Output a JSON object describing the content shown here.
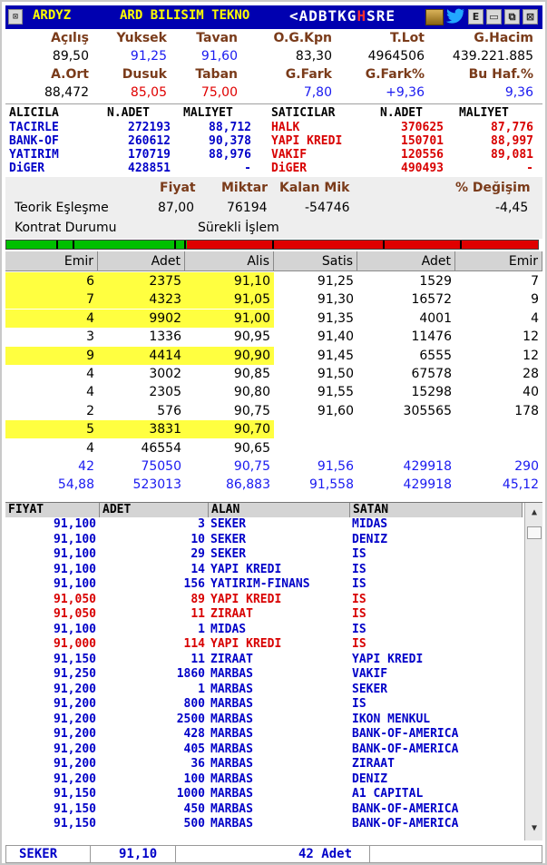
{
  "title": {
    "close": "⊠",
    "symbol": "ARDYZ",
    "company": "ARD BILISIM TEKNO",
    "flags_pre": "<ADBTKG",
    "flags_hl": "H",
    "flags_post": "SRE",
    "bird_icon": "twitter-bird",
    "btn_e": "E",
    "btn_min": "▭",
    "btn_max": "⧉",
    "btn_close": "⊠"
  },
  "summary": {
    "labels1": [
      "Açılış",
      "Yuksek",
      "Tavan",
      "O.G.Kpn",
      "T.Lot",
      "G.Hacim"
    ],
    "values1": [
      "89,50",
      "91,25",
      "91,60",
      "83,30",
      "4964506",
      "439.221.885"
    ],
    "labels2": [
      "A.Ort",
      "Dusuk",
      "Taban",
      "G.Fark",
      "G.Fark%",
      "Bu Haf.%"
    ],
    "values2": [
      "88,472",
      "85,05",
      "75,00",
      "7,80",
      "+9,36",
      "9,36"
    ]
  },
  "brokers": {
    "buy_headers": [
      "ALICILA",
      "N.ADET",
      "MALIYET"
    ],
    "sell_headers": [
      "SATICILAR",
      "N.ADET",
      "MALIYET"
    ],
    "rows": [
      {
        "buyer": "TACIRLE",
        "bq": "272193",
        "bc": "88,712",
        "seller": "HALK",
        "sq": "370625",
        "sc": "87,776"
      },
      {
        "buyer": "BANK-OF",
        "bq": "260612",
        "bc": "90,378",
        "seller": "YAPI KREDI",
        "sq": "150701",
        "sc": "88,997"
      },
      {
        "buyer": "YATIRIM",
        "bq": "170719",
        "bc": "88,976",
        "seller": "VAKIF",
        "sq": "120556",
        "sc": "89,081"
      },
      {
        "buyer": "DiGER",
        "bq": "428851",
        "bc": "-",
        "seller": "DiGER",
        "sq": "490493",
        "sc": "-"
      }
    ]
  },
  "theoretical": {
    "h_price": "Fiyat",
    "h_qty": "Miktar",
    "h_rem": "Kalan Mik",
    "h_chg": "% Değişim",
    "label": "Teorik Eşleşme",
    "price": "87,00",
    "qty": "76194",
    "rem": "-54746",
    "chg": "-4,45",
    "contract_label": "Kontrat Durumu",
    "contract_value": "Sürekli İşlem"
  },
  "depth_bar": {
    "buy_fraction": 0.34
  },
  "book": {
    "headers": [
      "Emir",
      "Adet",
      "Alis",
      "Satis",
      "Adet",
      "Emir"
    ],
    "rows": [
      {
        "be": "6",
        "ba": "2375",
        "bp": "91,10",
        "sp": "91,25",
        "sa": "1529",
        "se": "7",
        "hl": true
      },
      {
        "be": "7",
        "ba": "4323",
        "bp": "91,05",
        "sp": "91,30",
        "sa": "16572",
        "se": "9",
        "hl": true
      },
      {
        "be": "4",
        "ba": "9902",
        "bp": "91,00",
        "sp": "91,35",
        "sa": "4001",
        "se": "4",
        "hl": true
      },
      {
        "be": "3",
        "ba": "1336",
        "bp": "90,95",
        "sp": "91,40",
        "sa": "11476",
        "se": "12",
        "hl": false
      },
      {
        "be": "9",
        "ba": "4414",
        "bp": "90,90",
        "sp": "91,45",
        "sa": "6555",
        "se": "12",
        "hl": true
      },
      {
        "be": "4",
        "ba": "3002",
        "bp": "90,85",
        "sp": "91,50",
        "sa": "67578",
        "se": "28",
        "hl": false
      },
      {
        "be": "4",
        "ba": "2305",
        "bp": "90,80",
        "sp": "91,55",
        "sa": "15298",
        "se": "40",
        "hl": false
      },
      {
        "be": "2",
        "ba": "576",
        "bp": "90,75",
        "sp": "91,60",
        "sa": "305565",
        "se": "178",
        "hl": false
      },
      {
        "be": "5",
        "ba": "3831",
        "bp": "90,70",
        "sp": "",
        "sa": "",
        "se": "",
        "hl": true
      },
      {
        "be": "4",
        "ba": "46554",
        "bp": "90,65",
        "sp": "",
        "sa": "",
        "se": "",
        "hl": false
      }
    ],
    "total": {
      "be": "42",
      "ba": "75050",
      "bp": "90,75",
      "sp": "91,56",
      "sa": "429918",
      "se": "290"
    },
    "avg": {
      "be": "54,88",
      "ba": "523013",
      "bp": "86,883",
      "sp": "91,558",
      "sa": "429918",
      "se": "45,12"
    }
  },
  "trades": {
    "headers": [
      "FIYAT",
      "ADET",
      "ALAN",
      "SATAN"
    ],
    "rows": [
      {
        "p": "91,100",
        "q": "3",
        "b": "SEKER",
        "s": "MIDAS",
        "red": false
      },
      {
        "p": "91,100",
        "q": "10",
        "b": "SEKER",
        "s": "DENIZ",
        "red": false
      },
      {
        "p": "91,100",
        "q": "29",
        "b": "SEKER",
        "s": "IS",
        "red": false
      },
      {
        "p": "91,100",
        "q": "14",
        "b": "YAPI KREDI",
        "s": "IS",
        "red": false
      },
      {
        "p": "91,100",
        "q": "156",
        "b": "YATIRIM-FINANS",
        "s": "IS",
        "red": false
      },
      {
        "p": "91,050",
        "q": "89",
        "b": "YAPI KREDI",
        "s": "IS",
        "red": true
      },
      {
        "p": "91,050",
        "q": "11",
        "b": "ZIRAAT",
        "s": "IS",
        "red": true
      },
      {
        "p": "91,100",
        "q": "1",
        "b": "MIDAS",
        "s": "IS",
        "red": false
      },
      {
        "p": "91,000",
        "q": "114",
        "b": "YAPI KREDI",
        "s": "IS",
        "red": true
      },
      {
        "p": "91,150",
        "q": "11",
        "b": "ZIRAAT",
        "s": "YAPI KREDI",
        "red": false
      },
      {
        "p": "91,250",
        "q": "1860",
        "b": "MARBAS",
        "s": "VAKIF",
        "red": false
      },
      {
        "p": "91,200",
        "q": "1",
        "b": "MARBAS",
        "s": "SEKER",
        "red": false
      },
      {
        "p": "91,200",
        "q": "800",
        "b": "MARBAS",
        "s": "IS",
        "red": false
      },
      {
        "p": "91,200",
        "q": "2500",
        "b": "MARBAS",
        "s": "IKON MENKUL",
        "red": false
      },
      {
        "p": "91,200",
        "q": "428",
        "b": "MARBAS",
        "s": "BANK-OF-AMERICA",
        "red": false
      },
      {
        "p": "91,200",
        "q": "405",
        "b": "MARBAS",
        "s": "BANK-OF-AMERICA",
        "red": false
      },
      {
        "p": "91,200",
        "q": "36",
        "b": "MARBAS",
        "s": "ZIRAAT",
        "red": false
      },
      {
        "p": "91,200",
        "q": "100",
        "b": "MARBAS",
        "s": "DENIZ",
        "red": false
      },
      {
        "p": "91,150",
        "q": "1000",
        "b": "MARBAS",
        "s": "A1 CAPITAL",
        "red": false
      },
      {
        "p": "91,150",
        "q": "450",
        "b": "MARBAS",
        "s": "BANK-OF-AMERICA",
        "red": false
      },
      {
        "p": "91,150",
        "q": "500",
        "b": "MARBAS",
        "s": "BANK-OF-AMERICA",
        "red": false
      }
    ]
  },
  "status": {
    "broker": "SEKER",
    "price": "91,10",
    "qty": "42 Adet"
  }
}
